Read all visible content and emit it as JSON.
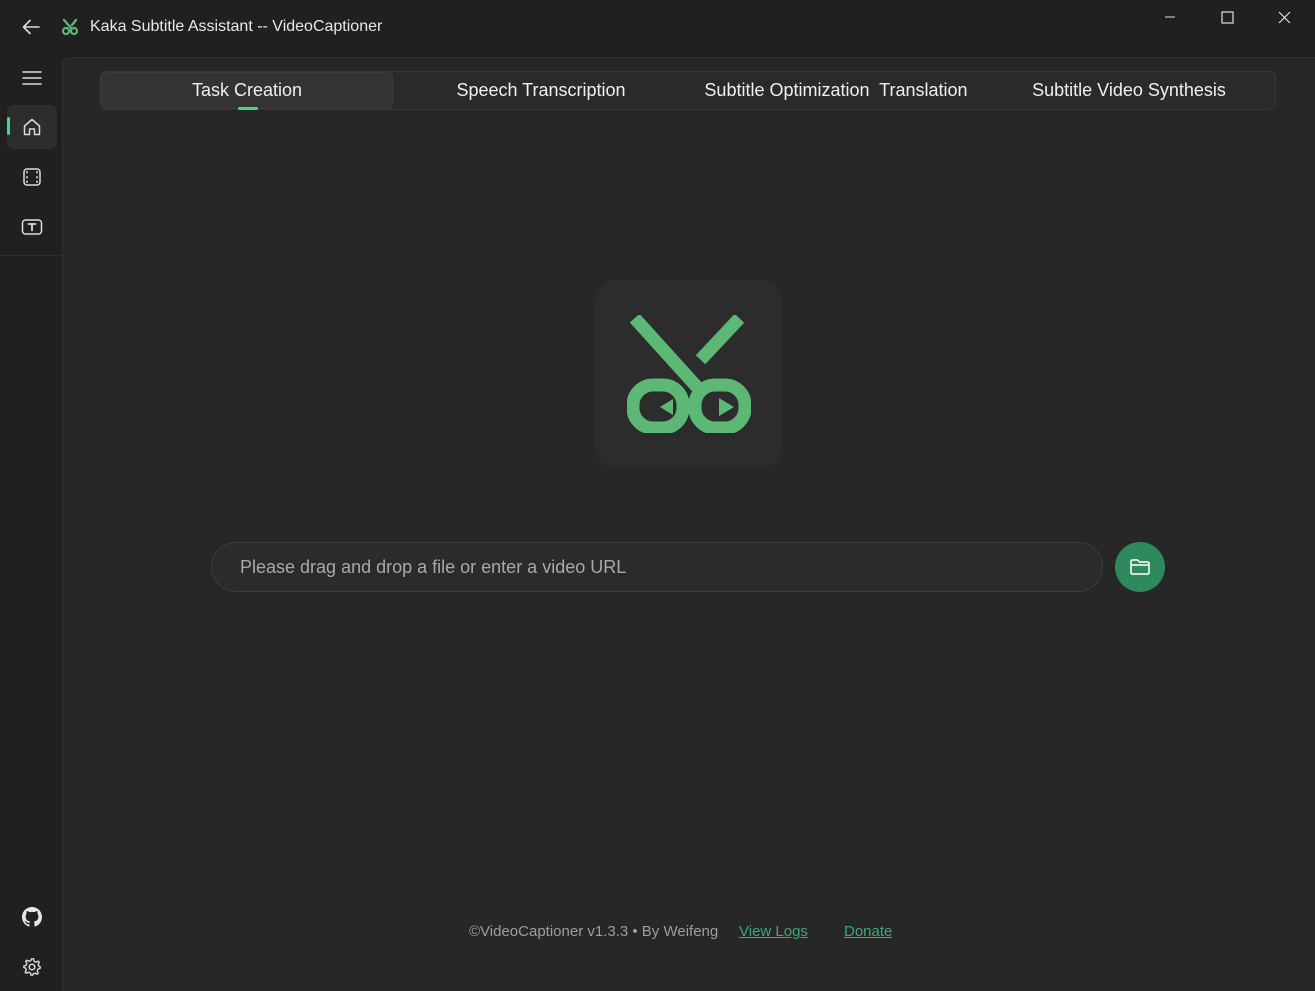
{
  "window": {
    "title": "Kaka Subtitle Assistant -- VideoCaptioner",
    "controls": [
      "minimize-icon",
      "maximize-icon",
      "close-icon"
    ]
  },
  "sidebar": {
    "items": [
      {
        "name": "menu",
        "icon": "hamburger-icon"
      },
      {
        "name": "home",
        "icon": "home-icon",
        "active": true
      },
      {
        "name": "video",
        "icon": "film-icon"
      },
      {
        "name": "subtitle",
        "icon": "text-box-icon"
      }
    ],
    "bottom_items": [
      {
        "name": "github",
        "icon": "github-icon"
      },
      {
        "name": "settings",
        "icon": "gear-icon"
      }
    ]
  },
  "tabs": [
    {
      "label": "Task Creation",
      "active": true
    },
    {
      "label": "Speech Transcription",
      "active": false
    },
    {
      "label": "Subtitle Optimization  Translation",
      "active": false
    },
    {
      "label": "Subtitle Video Synthesis",
      "active": false
    }
  ],
  "main": {
    "logo_icon": "scissors-play-icon",
    "input_value": "",
    "input_placeholder": "Please drag and drop a file or enter a video URL",
    "browse_icon": "folder-icon"
  },
  "footer": {
    "copyright": "©VideoCaptioner v1.3.3 • By Weifeng",
    "view_logs": "View Logs",
    "donate": "Donate"
  },
  "colors": {
    "accent": "#3ddc84",
    "logo_green": "#5cb874",
    "button_green": "#2e8a5c",
    "link_green": "#3fa877",
    "background": "#202020",
    "panel": "#272727"
  }
}
